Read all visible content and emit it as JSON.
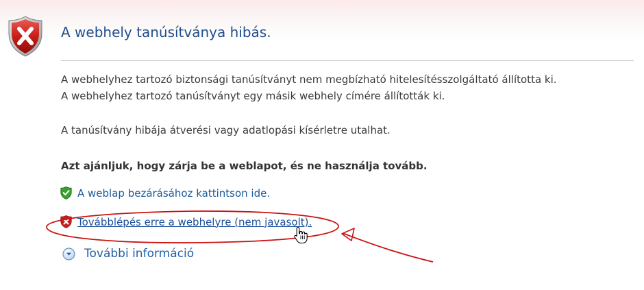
{
  "header": {
    "title": "A webhely tanúsítványa hibás."
  },
  "message": {
    "line1": "A webhelyhez tartozó biztonsági tanúsítványt nem megbízható hitelesítésszolgáltató állította ki.",
    "line2": "A webhelyhez tartozó tanúsítványt egy másik webhely címére állították ki.",
    "line3": "A tanúsítvány hibája átverési vagy adatlopási kísérletre utalhat.",
    "recommendation": "Azt ajánljuk, hogy zárja be a weblapot, és ne használja tovább."
  },
  "actions": {
    "close_label": "A weblap bezárásához kattintson ide.",
    "close_icon": "green-check-shield-icon",
    "continue_label": "Továbblépés erre a webhelyre (nem javasolt).",
    "continue_icon": "red-x-shield-icon",
    "more_info_label": "További információ",
    "more_info_icon": "expand-arrow-icon"
  },
  "colors": {
    "title": "#1f4d8c",
    "link": "#1a5a9a",
    "annotation": "#cc1111",
    "error_shield": "#c8201f",
    "ok_shield": "#3a9a2a"
  }
}
